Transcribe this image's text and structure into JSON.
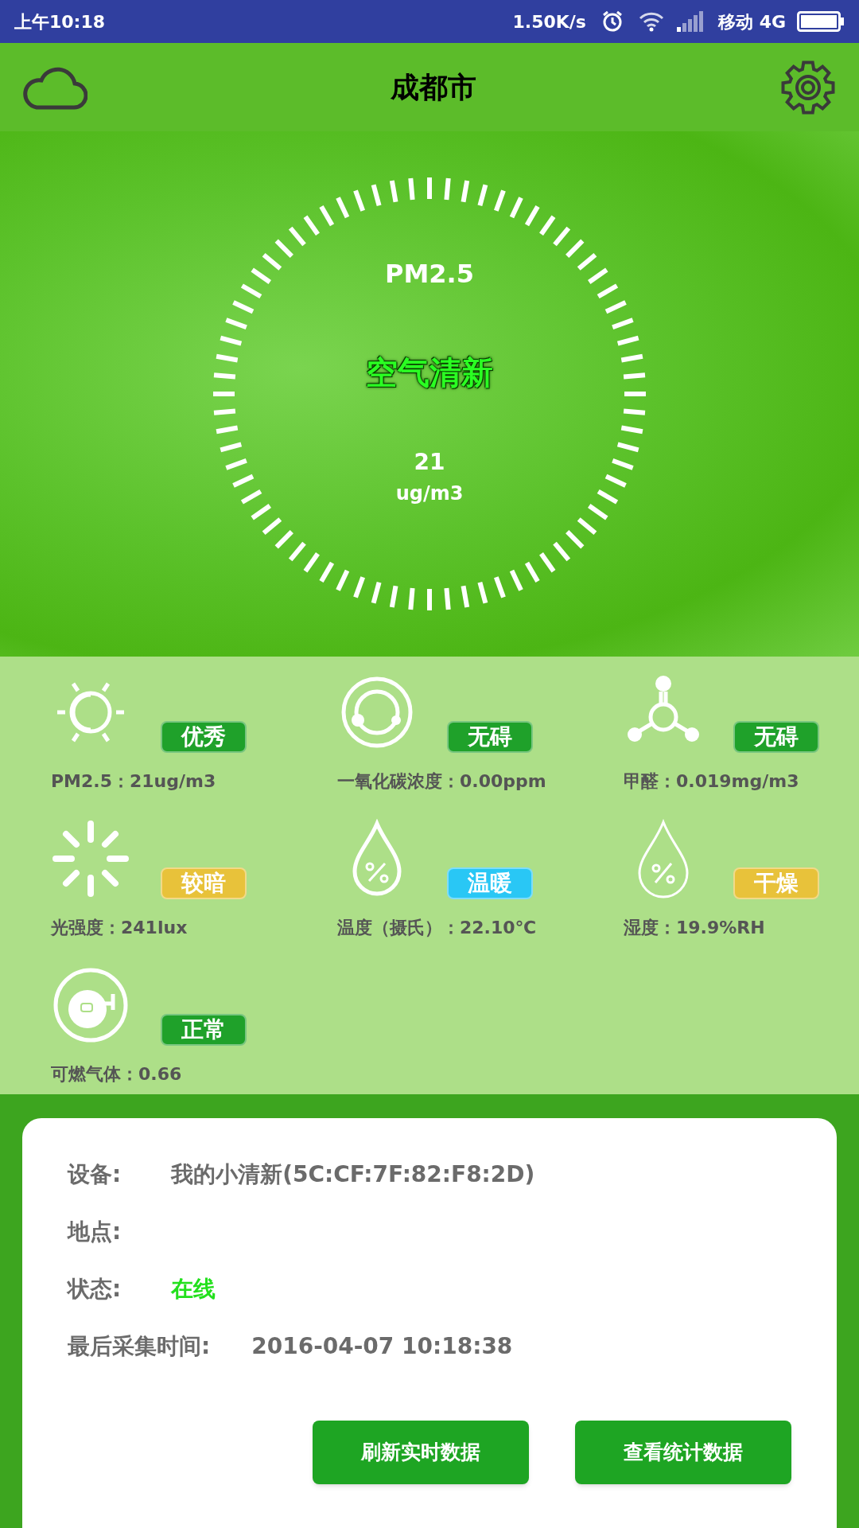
{
  "status_bar": {
    "time": "上午10:18",
    "speed": "1.50K/s",
    "carrier": "移动 4G"
  },
  "header": {
    "title": "成都市"
  },
  "dial": {
    "label": "PM2.5",
    "quality": "空气清新",
    "value": "21",
    "unit": "ug/m3"
  },
  "sensors": [
    {
      "badge": "优秀",
      "color": "#1fa12a",
      "reading": "PM2.5：21ug/m3"
    },
    {
      "badge": "无碍",
      "color": "#1fa12a",
      "reading": "一氧化碳浓度：0.00ppm"
    },
    {
      "badge": "无碍",
      "color": "#1fa12a",
      "reading": "甲醛：0.019mg/m3"
    },
    {
      "badge": "较暗",
      "color": "#e8c23a",
      "reading": "光强度：241lux"
    },
    {
      "badge": "温暖",
      "color": "#29c7f5",
      "reading": "温度（摄氏）：22.10℃"
    },
    {
      "badge": "干燥",
      "color": "#e8c23a",
      "reading": "湿度：19.9%RH"
    },
    {
      "badge": "正常",
      "color": "#1fa12a",
      "reading": "可燃气体：0.66"
    }
  ],
  "device": [
    {
      "label": "设备:",
      "value": "我的小清新(5C:CF:7F:82:F8:2D)",
      "kind": "plain"
    },
    {
      "label": "地点:"
    },
    {
      "label": "状态:",
      "value": "在线",
      "kind": "status"
    },
    {
      "label": "最后采集时间:",
      "value": "2016-04-07 10:18:38",
      "kind": "time"
    }
  ],
  "buttons": [
    "刷新实时数据",
    "查看统计数据"
  ]
}
